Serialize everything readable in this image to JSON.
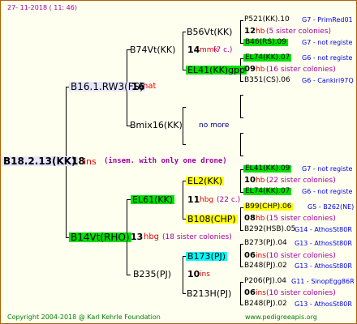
{
  "header": {
    "date": "27- 11-2018 ( 11: 46)"
  },
  "footer": {
    "copyright": "Copyright 2004-2018 @ Karl Kehrle Foundation",
    "site": "www.pedigreeapis.org"
  },
  "colors": {
    "green": "#00e000",
    "yellow": "#ffff00",
    "cyan": "#00ffff",
    "lavender": "#e6e6ff",
    "red": "#e00000",
    "blue": "#0000ee",
    "brown": "#8b0000",
    "magenta": "#a000a0"
  },
  "root": {
    "id": "B18.2.13(KK)",
    "num": "18",
    "suffix": "ins",
    "note": "(insem. with only one drone)"
  },
  "sire_line": {
    "id": "B16.1.RW3(FS)",
    "num": "16",
    "suffix": "nat",
    "a": {
      "id": "B74Vt(KK)",
      "num": "14",
      "suffix": "mmk",
      "sis": "(7 c.)",
      "aa": {
        "id": "B56Vt(KK)",
        "num": "12",
        "suffix": "hb",
        "sis": "(5 sister colonies)",
        "p1": {
          "id": "P521(KK).10",
          "note": "G7 - PrimRed01"
        },
        "p2": {
          "id": "B46(RS).09",
          "note": "G7 - not registe"
        }
      },
      "ab": {
        "id": "EL41(KK)gpp",
        "num": "09",
        "suffix": "hb",
        "sis": "(16 sister colonies)",
        "p1": {
          "id": "EL74(KK).07",
          "note": "G6 - not registe"
        },
        "p2": {
          "id": "B351(CS).06",
          "note": "G6 - Cankiri97Q"
        }
      }
    },
    "b": {
      "id": "Bmix16(KK)",
      "more": "no more"
    }
  },
  "dam_line": {
    "id": "B14Vt(RHO)",
    "num": "13",
    "suffix": "hbg",
    "sis": "(18 sister colonies)",
    "a": {
      "id": "EL61(KK)",
      "num": "11",
      "suffix": "hbg",
      "sis": "(22 c.)",
      "aa": {
        "id": "EL2(KK)",
        "num": "10",
        "suffix": "hb",
        "sis": "(22 sister colonies)",
        "p1": {
          "id": "EL41(KK).09",
          "note": "G7 - not registe"
        },
        "p2": {
          "id": "EL74(KK).07",
          "note": "G6 - not registe"
        }
      },
      "ab": {
        "id": "B108(CHP)",
        "num": "08",
        "suffix": "hb",
        "sis": "(15 sister colonies)",
        "p1": {
          "id": "B99(CHP).06",
          "note": "G5 - B262(NE)"
        },
        "p2": {
          "id": "B292(HSB).05",
          "note": "G14 - AthosSt80R"
        }
      }
    },
    "b": {
      "id": "B235(PJ)",
      "num": "10",
      "suffix": "ins",
      "ba": {
        "id": "B173(PJ)",
        "num": "06",
        "suffix": "ins",
        "sis": "(10 sister colonies)",
        "p1": {
          "id": "B273(PJ).04",
          "note": "G13 - AthosSt80R"
        },
        "p2": {
          "id": "B248(PJ).02",
          "note": "G13 - AthosSt80R"
        }
      },
      "bb": {
        "id": "B213H(PJ)",
        "num": "06",
        "suffix": "ins",
        "sis": "(10 sister colonies)",
        "p1": {
          "id": "P206(PJ).04",
          "note": "G11 - SinopEgg86R"
        },
        "p2": {
          "id": "B248(PJ).02",
          "note": "G13 - AthosSt80R"
        }
      }
    }
  }
}
